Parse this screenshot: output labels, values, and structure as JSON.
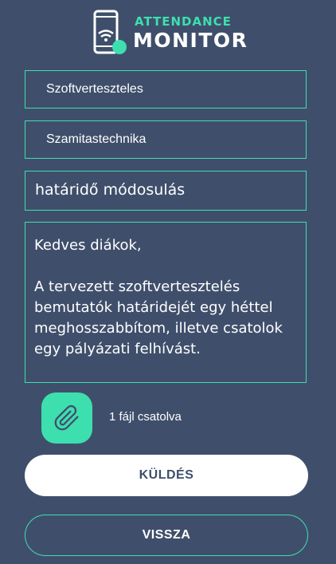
{
  "logo": {
    "top_text": "ATTENDANCE",
    "bottom_text": "MONITOR",
    "icon": "phone-wifi-icon"
  },
  "form": {
    "subject_value": "Szoftverteszteles",
    "course_value": "Szamitastechnika",
    "title_value": "határidő módosulás",
    "message_value": "Kedves diákok,\n\nA tervezett szoftvertesztelés bemutatók határidejét egy héttel meghosszabbítom, illetve csatolok egy pályázati felhívást."
  },
  "attachment": {
    "icon": "paperclip-icon",
    "status_text": "1 fájl csatolva"
  },
  "buttons": {
    "send_label": "KÜLDÉS",
    "back_label": "VISSZA"
  },
  "colors": {
    "background": "#3f4f6b",
    "accent": "#3ddfae",
    "text": "#ffffff"
  }
}
